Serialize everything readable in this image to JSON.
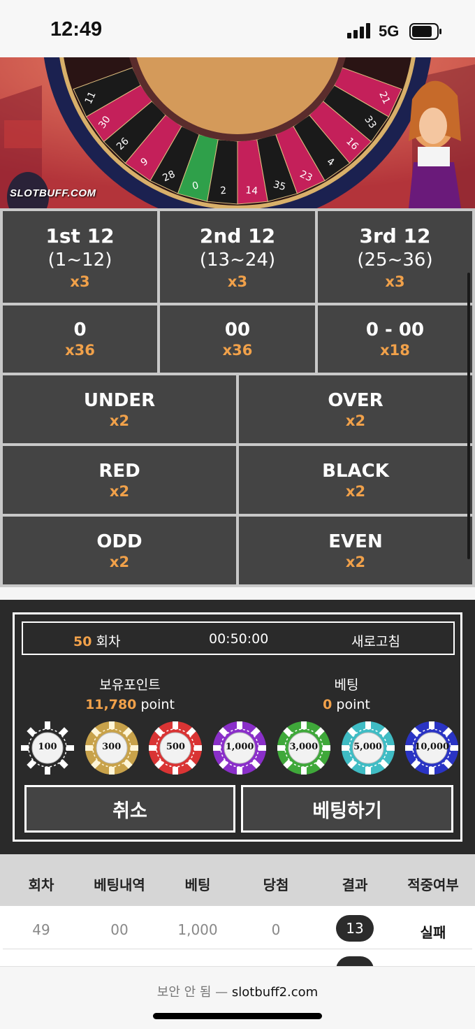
{
  "status_bar": {
    "time": "12:49",
    "network": "5G"
  },
  "banner": {
    "logo_text": "SLOTBUFF.COM",
    "wheel_numbers": [
      "11",
      "30",
      "26",
      "9",
      "28",
      "0",
      "2",
      "14",
      "35",
      "23",
      "4",
      "16",
      "33",
      "21"
    ]
  },
  "bet_grid": {
    "dozens": [
      {
        "label": "1st 12",
        "range": "(1~12)",
        "payout": "x3"
      },
      {
        "label": "2nd 12",
        "range": "(13~24)",
        "payout": "x3"
      },
      {
        "label": "3rd 12",
        "range": "(25~36)",
        "payout": "x3"
      }
    ],
    "zeros": [
      {
        "label": "0",
        "payout": "x36"
      },
      {
        "label": "00",
        "payout": "x36"
      },
      {
        "label": "0 - 00",
        "payout": "x18"
      }
    ],
    "pairs": [
      {
        "left": {
          "label": "UNDER",
          "payout": "x2"
        },
        "right": {
          "label": "OVER",
          "payout": "x2"
        }
      },
      {
        "left": {
          "label": "RED",
          "payout": "x2"
        },
        "right": {
          "label": "BLACK",
          "payout": "x2"
        }
      },
      {
        "left": {
          "label": "ODD",
          "payout": "x2"
        },
        "right": {
          "label": "EVEN",
          "payout": "x2"
        }
      }
    ]
  },
  "panel": {
    "round_number": "50",
    "round_suffix": " 회차",
    "timer": "00:50:00",
    "refresh_label": "새로고침",
    "held_points_label": "보유포인트",
    "held_points_value": "11,780",
    "betting_label": "베팅",
    "betting_value": "0",
    "point_unit": " point",
    "chips": [
      {
        "value": "100",
        "color": "#2a2a2a",
        "edge": "#ffffff"
      },
      {
        "value": "300",
        "color": "#c8a24a",
        "edge": "#fff6d8"
      },
      {
        "value": "500",
        "color": "#d93434",
        "edge": "#ffffff"
      },
      {
        "value": "1,000",
        "color": "#8a2fc9",
        "edge": "#ffffff"
      },
      {
        "value": "3,000",
        "color": "#3fa83a",
        "edge": "#ffffff"
      },
      {
        "value": "5,000",
        "color": "#3fbcc4",
        "edge": "#ffffff"
      },
      {
        "value": "10,000",
        "color": "#2a34c4",
        "edge": "#ffffff"
      }
    ],
    "cancel_label": "취소",
    "bet_label": "베팅하기"
  },
  "history": {
    "headers": [
      "회차",
      "베팅내역",
      "베팅",
      "당첨",
      "결과",
      "적중여부"
    ],
    "rows": [
      {
        "round": "49",
        "detail": "00",
        "bet": "1,000",
        "win": "0",
        "result": "13",
        "hit": "실패"
      }
    ]
  },
  "browser": {
    "insecure_label": "보안 안 됨 —",
    "domain": "slotbuff2.com"
  }
}
